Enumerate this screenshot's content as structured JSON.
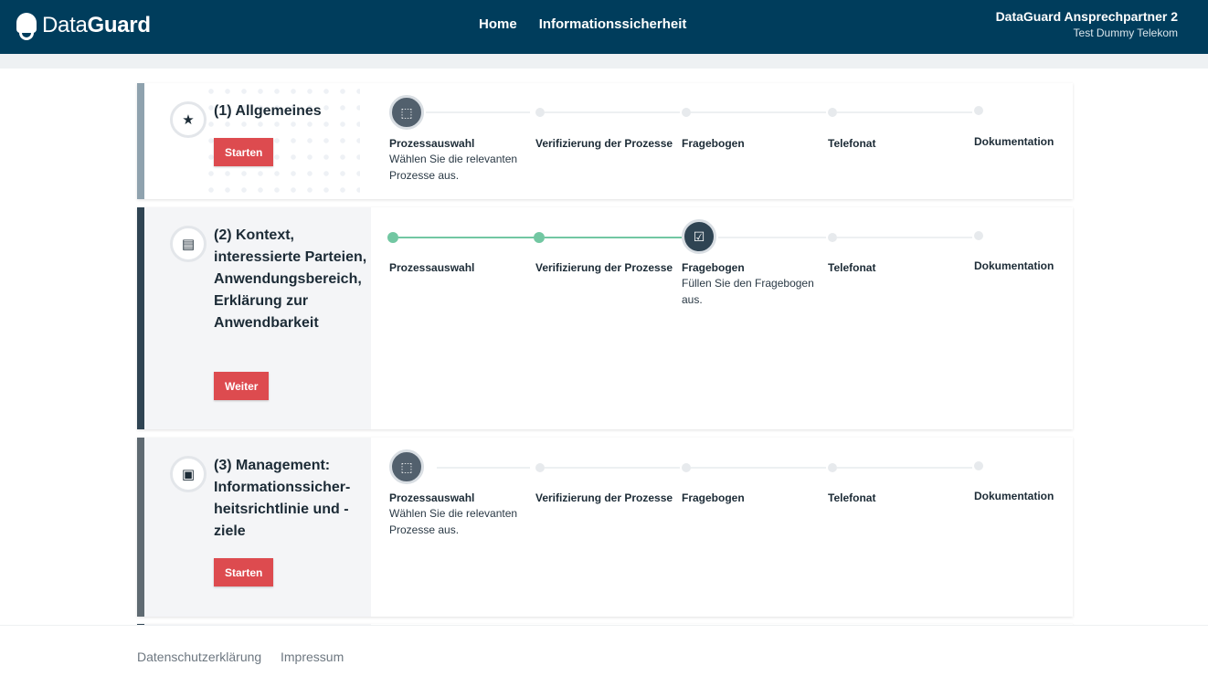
{
  "header": {
    "logo_light": "Data",
    "logo_bold": "Guard",
    "nav": [
      "Home",
      "Informationssicherheit"
    ],
    "user_name": "DataGuard Ansprechpartner 2",
    "user_org": "Test Dummy Telekom"
  },
  "colors": {
    "header_bg": "#003d5c",
    "button_red": "#dd4b4f",
    "progress_green": "#72c7a2",
    "accent_card1": "#8fa2ae",
    "accent_card2": "#2f4453",
    "accent_card3": "#5f6a72"
  },
  "step_labels": [
    "Prozessauswahl",
    "Verifizierung der Prozesse",
    "Fragebogen",
    "Telefonat",
    "Dokumentation"
  ],
  "cards": [
    {
      "title": "(1) Allgemeines",
      "icon": "star-list-icon",
      "button": "Starten",
      "active_step": "Prozessauswahl",
      "active_desc": "Wählen Sie die relevanten Prozesse aus."
    },
    {
      "title": "(2) Kontext, interessierte Parteien, Anwendungsbereich, Erklärung zur Anwendbarkeit",
      "icon": "document-icon",
      "button": "Weiter",
      "active_step": "Fragebogen",
      "active_desc": "Füllen Sie den Fragebogen aus."
    },
    {
      "title": "(3) Management: Informationssicher-heitsrichtlinie und -ziele",
      "icon": "clipboard-icon",
      "button": "Starten",
      "active_step": "Prozessauswahl",
      "active_desc": "Wählen Sie die relevanten Prozesse aus."
    }
  ],
  "footer": {
    "privacy": "Datenschutzerklärung",
    "imprint": "Impressum"
  }
}
